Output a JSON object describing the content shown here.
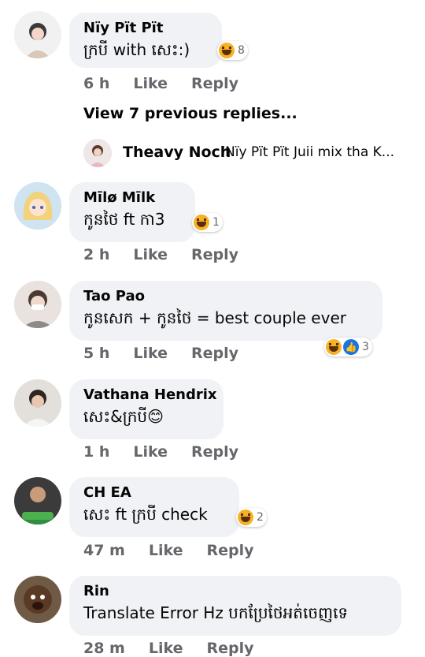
{
  "thread": {
    "view_previous": "View 7 previous replies...",
    "reply_preview": {
      "author": "Theavy Noch",
      "text": "Nïy Pït Pït  Juii mix tha K..."
    }
  },
  "comments": [
    {
      "author": "Nïy Pït Pït",
      "text": "ក្របី with សេះ:)",
      "time": "6 h",
      "like": "Like",
      "reply": "Reply",
      "reactions": [
        "haha"
      ],
      "reaction_count": "8"
    },
    {
      "author": "Mīlø Mīlk",
      "text": "កូនថៃ ft កា3",
      "time": "2 h",
      "like": "Like",
      "reply": "Reply",
      "reactions": [
        "haha"
      ],
      "reaction_count": "1"
    },
    {
      "author": "Tao Pao",
      "text": "កូនសេក + កូនថៃ = best couple ever",
      "time": "5 h",
      "like": "Like",
      "reply": "Reply",
      "reactions": [
        "haha",
        "like"
      ],
      "reaction_count": "3"
    },
    {
      "author": "Vathana Hendrix",
      "text": "សេះ&ក្របី😊",
      "time": "1 h",
      "like": "Like",
      "reply": "Reply"
    },
    {
      "author": "CH EA",
      "text": "សេះ ft ក្របី check",
      "time": "47 m",
      "like": "Like",
      "reply": "Reply",
      "reactions": [
        "haha"
      ],
      "reaction_count": "2"
    },
    {
      "author": "Rin",
      "text": "Translate Error Hz បកប្រែថៃអត់ចេញទេ",
      "time": "28 m",
      "like": "Like",
      "reply": "Reply"
    }
  ]
}
